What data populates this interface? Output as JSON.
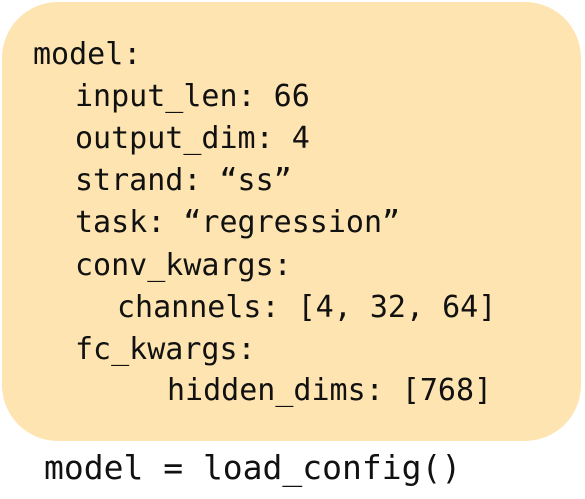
{
  "yaml": {
    "lines": [
      "model:",
      "input_len: 66",
      "output_dim: 4",
      "strand: “ss”",
      "task: “regression”",
      "conv_kwargs:",
      "channels: [4, 32, 64]",
      "fc_kwargs:",
      "hidden_dims: [768]"
    ]
  },
  "caption": "model = load_config()",
  "colors": {
    "box_fill": "#fde4b0",
    "text": "#111111"
  }
}
